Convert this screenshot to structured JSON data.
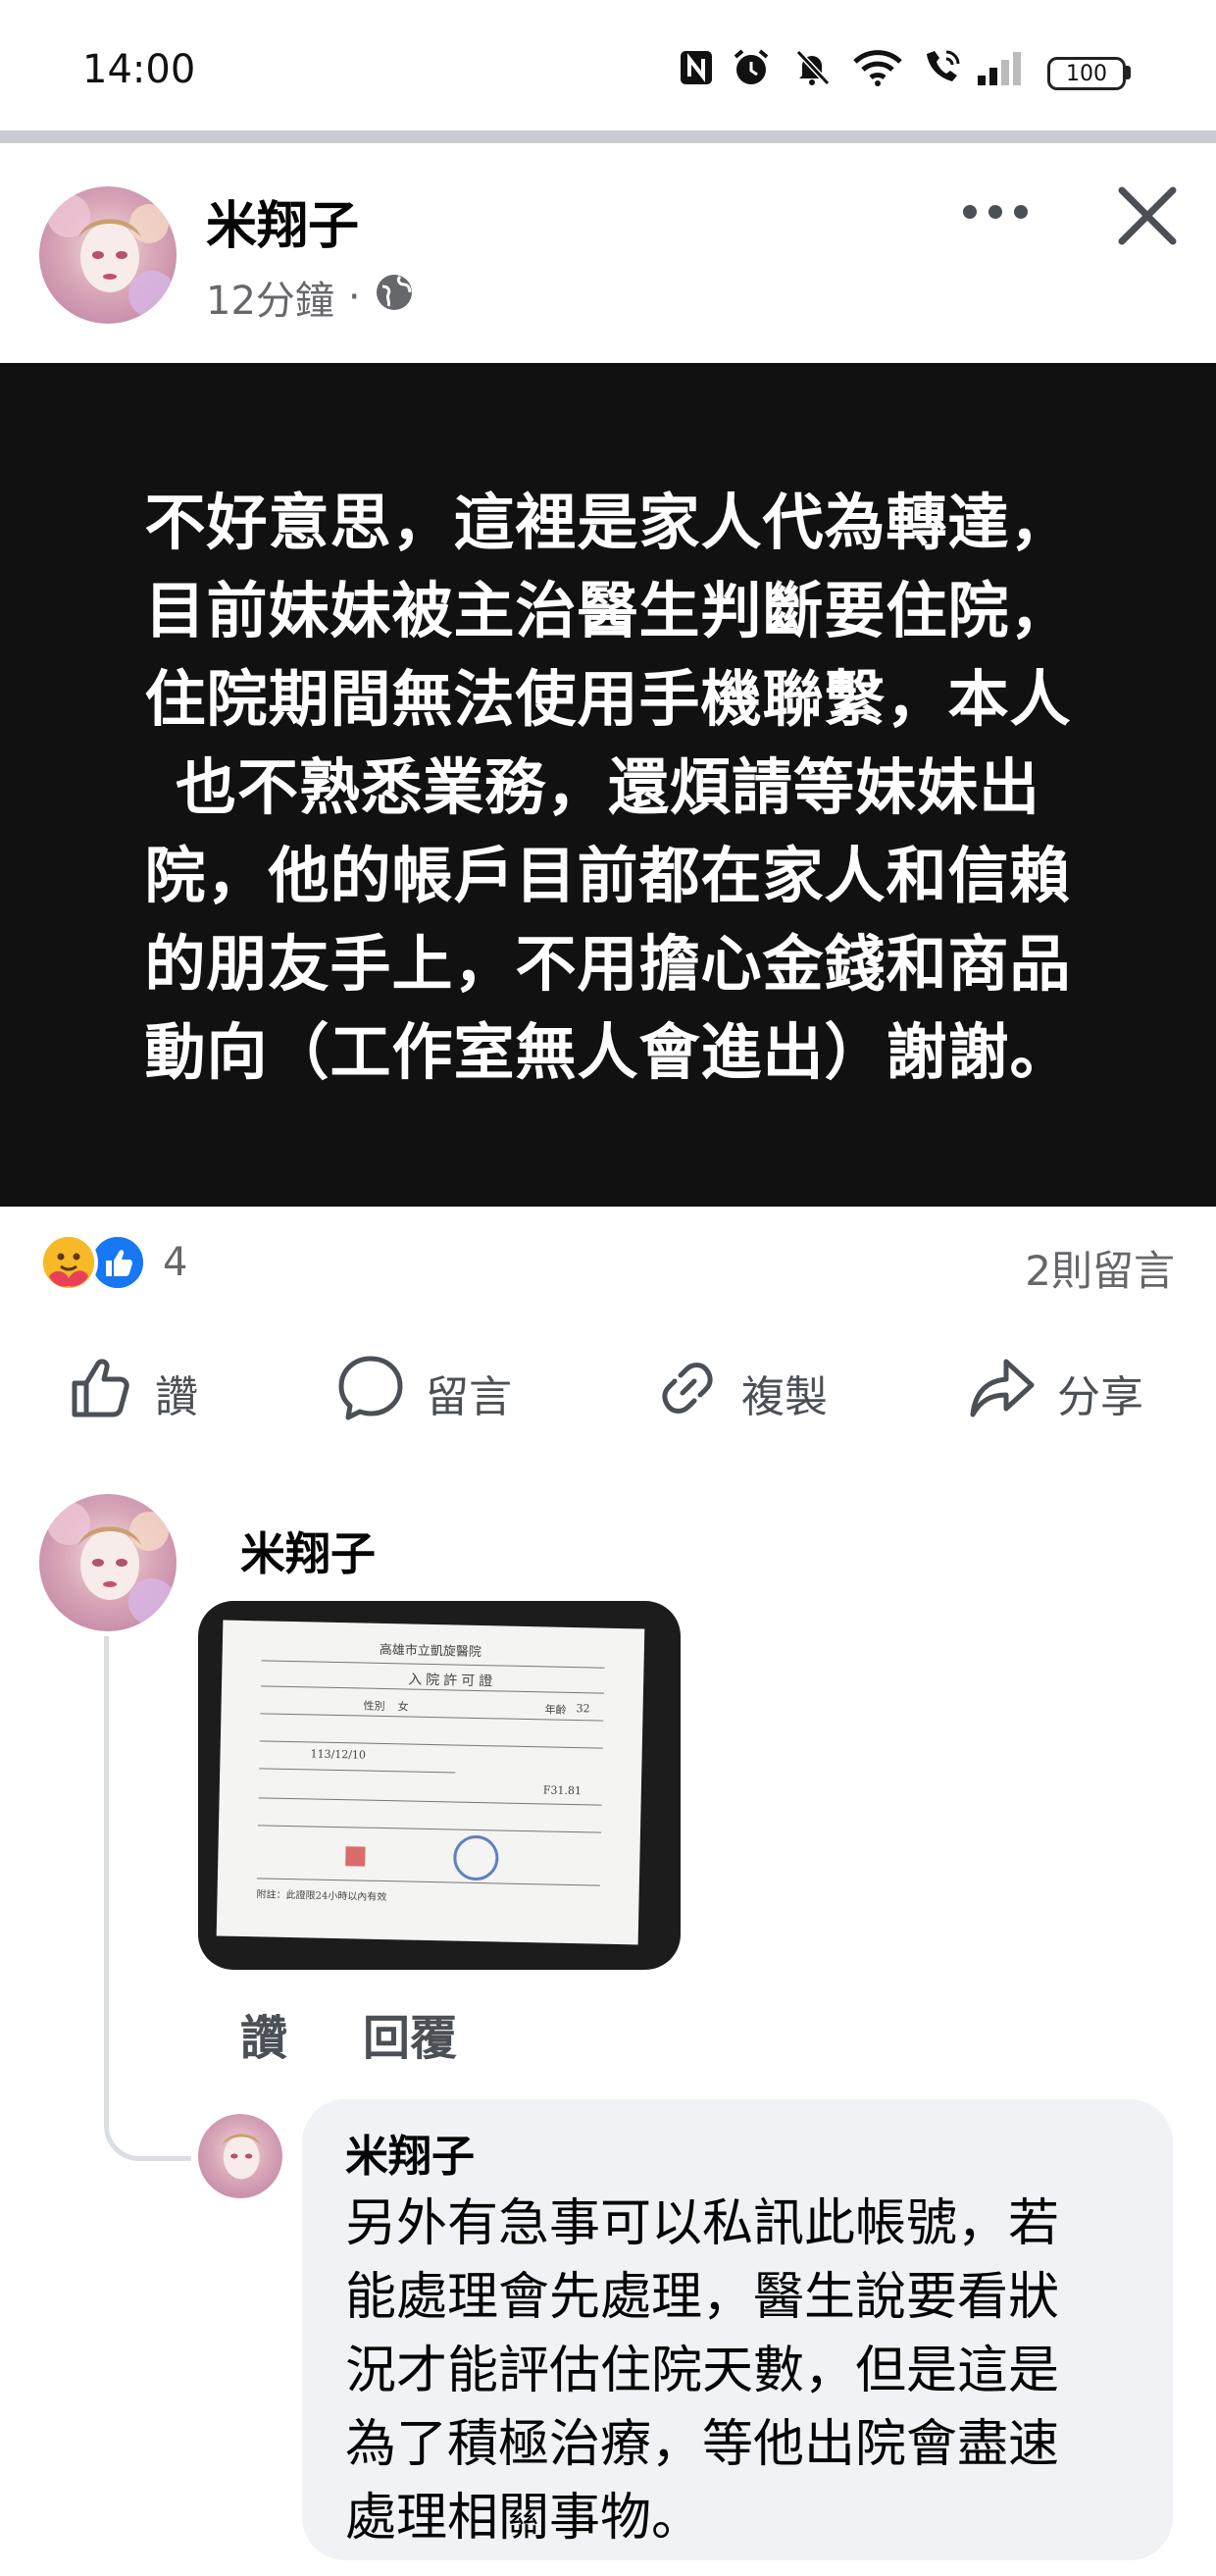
{
  "status_bar": {
    "time": "14:00",
    "battery": "100",
    "icons": [
      "nfc-icon",
      "alarm-icon",
      "mute-icon",
      "wifi-icon",
      "wifi-call-icon",
      "signal-icon"
    ]
  },
  "post": {
    "author": "米翔子",
    "time": "12分鐘",
    "dot": "·",
    "privacy_icon": "globe-icon",
    "text": "不好意思，這裡是家人代為轉達，目前妹妹被主治醫生判斷要住院，住院期間無法使用手機聯繫，本人也不熟悉業務，還煩請等妹妹出院，他的帳戶目前都在家人和信賴的朋友手上，不用擔心金錢和商品動向（工作室無人會進出）謝謝。",
    "text_lines": [
      "不好意思，這裡是家人代為轉達，",
      "目前妹妹被主治醫生判斷要住院，",
      "住院期間無法使用手機聯繫，本人",
      "也不熟悉業務，還煩請等妹妹出",
      "院，他的帳戶目前都在家人和信賴",
      "的朋友手上，不用擔心金錢和商品",
      "動向（工作室無人會進出）謝謝。"
    ],
    "reaction_count": "4",
    "comment_count": "2則留言",
    "actions": [
      {
        "label": "讚",
        "icon": "like-icon"
      },
      {
        "label": "留言",
        "icon": "comment-icon"
      },
      {
        "label": "複製",
        "icon": "copy-link-icon"
      },
      {
        "label": "分享",
        "icon": "share-icon"
      }
    ]
  },
  "comments": [
    {
      "author": "米翔子",
      "attachment": {
        "hospital": "高雄市立凱旋醫院",
        "form_title": "入院許可證",
        "fields": {
          "sex_label": "性別",
          "sex": "女",
          "age_label": "年齡",
          "age": "32",
          "date": "113/12/10",
          "code": "F31.81",
          "footer": "附註：此證限24小時以內有效"
        }
      },
      "like_label": "讚",
      "reply_label": "回覆"
    },
    {
      "author": "米翔子",
      "text_lines": [
        "另外有急事可以私訊此帳號，若",
        "能處理會先處理，醫生說要看狀",
        "況才能評估住院天數，但是這是",
        "為了積極治療，等他出院會盡速",
        "處理相關事物。"
      ]
    }
  ],
  "colors": {
    "post_bg": "#111111",
    "secondary_text": "#65676b",
    "like_blue": "#1877f2",
    "bubble_bg": "#f0f2f5"
  }
}
